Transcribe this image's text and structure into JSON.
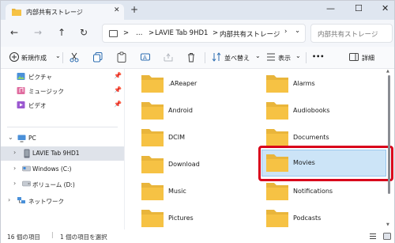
{
  "window": {
    "tab_title": "内部共有ストレージ",
    "new_tab": "+",
    "tab_close": "✕",
    "minimize": "—",
    "maximize": "☐",
    "close": "✕"
  },
  "address": {
    "more": "…",
    "segments": [
      "LAVIE Tab 9HD1",
      "内部共有ストレージ"
    ],
    "separators": [
      ">",
      ">",
      ">"
    ],
    "dropdown": "⌄",
    "refresh": "↻",
    "search_placeholder": "内部共有ストレージ"
  },
  "commands": {
    "new": "新規作成",
    "sort": "並べ替え",
    "view": "表示",
    "more": "•••",
    "details": "詳細"
  },
  "nav": {
    "quick": [
      {
        "label": "ピクチャ",
        "icon": "pictures-icon"
      },
      {
        "label": "ミュージック",
        "icon": "music-icon"
      },
      {
        "label": "ビデオ",
        "icon": "videos-icon"
      }
    ],
    "pc": "PC",
    "device": "LAVIE Tab 9HD1",
    "windows": "Windows (C:)",
    "volume": "ボリューム (D:)",
    "network": "ネットワーク"
  },
  "folders": {
    "left": [
      ".AReaper",
      "Android",
      "DCIM",
      "Download",
      "Music",
      "Pictures"
    ],
    "right": [
      "Alarms",
      "Audiobooks",
      "Documents",
      "Movies",
      "Notifications",
      "Podcasts"
    ]
  },
  "status": {
    "count": "16 個の項目",
    "selected": "1 個の項目を選択"
  },
  "colors": {
    "accent_highlight": "#d9001b",
    "selection": "#cce4f7",
    "folder": "#f6c244"
  }
}
